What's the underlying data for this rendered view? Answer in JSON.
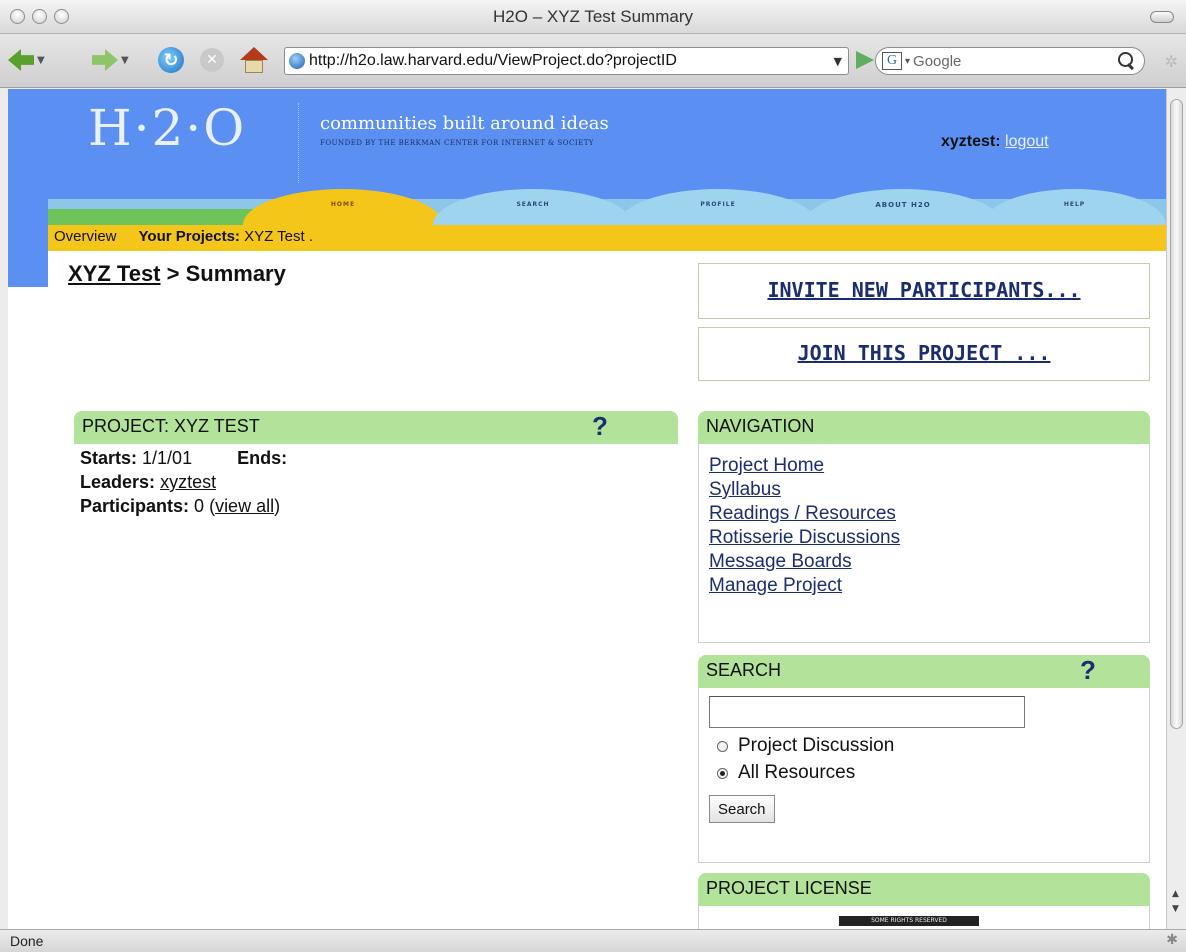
{
  "window": {
    "title": "H2O – XYZ Test Summary",
    "url": "http://h2o.law.harvard.edu/ViewProject.do?projectID",
    "search_placeholder": "Google",
    "status": "Done"
  },
  "site": {
    "logo": "H·2·O",
    "tagline": "communities built around ideas",
    "founded": "FOUNDED BY THE BERKMAN CENTER FOR INTERNET & SOCIETY",
    "username": "xyztest:",
    "logout": "logout",
    "tabs": [
      "HOME",
      "SEARCH",
      "PROFILE",
      "ABOUT H2O",
      "HELP"
    ],
    "subnav": {
      "overview": "Overview",
      "projects_label": "Your Projects:",
      "projects_value": "XYZ Test ."
    }
  },
  "breadcrumb": {
    "link": "XYZ Test",
    "rest": " > Summary"
  },
  "actions": {
    "invite": "INVITE NEW PARTICIPANTS...",
    "join": "JOIN THIS PROJECT ..."
  },
  "project": {
    "header": "PROJECT: XYZ TEST",
    "help": "?",
    "starts_label": "Starts:",
    "starts_value": "1/1/01",
    "ends_label": "Ends:",
    "leaders_label": "Leaders:",
    "leader": "xyztest",
    "participants_label": "Participants:",
    "participants_value": "0",
    "view_all": "view all"
  },
  "navigation": {
    "header": "NAVIGATION",
    "links": [
      "Project Home",
      "Syllabus",
      "Readings / Resources",
      "Rotisserie Discussions",
      "Message Boards",
      "Manage Project"
    ]
  },
  "search": {
    "header": "SEARCH",
    "help": "?",
    "options": [
      "Project Discussion",
      "All Resources"
    ],
    "selected": "All Resources",
    "button": "Search"
  },
  "license": {
    "header": "PROJECT LICENSE",
    "badge": "SOME RIGHTS RESERVED"
  },
  "colors": {
    "banner": "#5b8ff2",
    "subnav": "#f5c61a",
    "panel_header": "#b3e29a",
    "link": "#1b2d6e"
  }
}
